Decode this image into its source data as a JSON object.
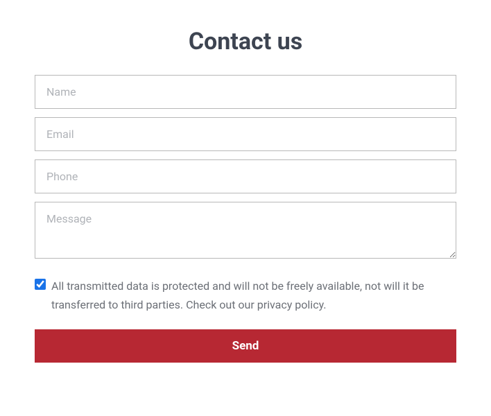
{
  "title": "Contact us",
  "fields": {
    "name": {
      "placeholder": "Name",
      "value": ""
    },
    "email": {
      "placeholder": "Email",
      "value": ""
    },
    "phone": {
      "placeholder": "Phone",
      "value": ""
    },
    "message": {
      "placeholder": "Message",
      "value": ""
    }
  },
  "consent": {
    "checked": true,
    "text": "All transmitted data is protected and will not be freely available, not will it be transferred to third parties. Check out our privacy policy."
  },
  "submit": {
    "label": "Send"
  },
  "colors": {
    "primary_button": "#b72833",
    "text_muted": "#6b6f76",
    "heading": "#3d4451"
  }
}
